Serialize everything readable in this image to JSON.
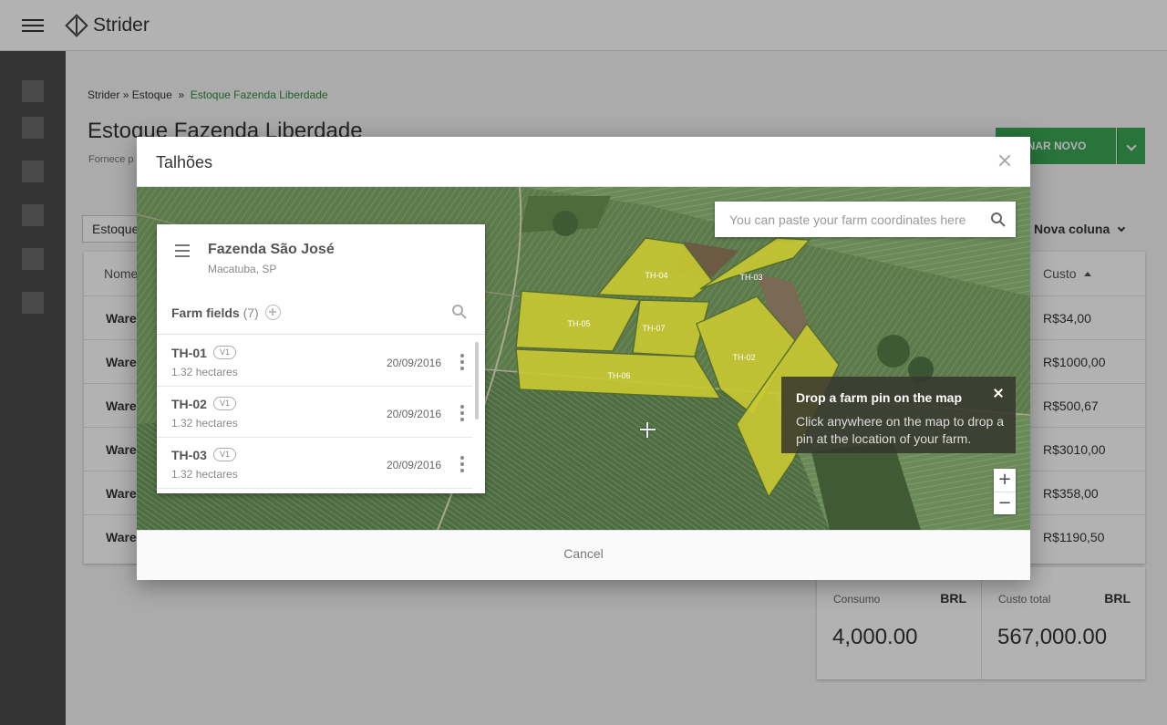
{
  "app": {
    "brand": "Strider"
  },
  "breadcrumb": {
    "root": "Strider",
    "sep1": "»",
    "section": "Estoque",
    "sep2": "»",
    "current": "Estoque Fazenda Liberdade"
  },
  "page": {
    "title": "Estoque Fazenda Liberdade",
    "subtitle": "Fornece p",
    "add_button": "ICIONAR NOVO",
    "filter_value": "Estoque",
    "new_column": "Nova coluna"
  },
  "table": {
    "col_name": "Nome",
    "col_cost": "Custo",
    "rows": [
      {
        "name": "Warel",
        "cost": "R$34,00"
      },
      {
        "name": "Warel",
        "cost": "R$1000,00"
      },
      {
        "name": "Warel",
        "cost": "R$500,67"
      },
      {
        "name": "Warel",
        "cost": "R$3010,00"
      },
      {
        "name": "Warel",
        "cost": "R$358,00"
      },
      {
        "name": "Warel",
        "cost": "R$1190,50"
      }
    ]
  },
  "summary": {
    "consumo_label": "Consumo",
    "consumo_currency": "BRL",
    "consumo_value": "4,000.00",
    "total_label": "Custo total",
    "total_currency": "BRL",
    "total_value": "567,000.00"
  },
  "modal": {
    "title": "Talhões",
    "cancel": "Cancel",
    "farm": {
      "name": "Fazenda São José",
      "location": "Macatuba, SP"
    },
    "fields_title": "Farm fields",
    "fields_count": "(7)",
    "fields": [
      {
        "name": "TH-01",
        "version": "V1",
        "area": "1.32 hectares",
        "date": "20/09/2016"
      },
      {
        "name": "TH-02",
        "version": "V1",
        "area": "1.32 hectares",
        "date": "20/09/2016"
      },
      {
        "name": "TH-03",
        "version": "V1",
        "area": "1.32 hectares",
        "date": "20/09/2016"
      }
    ],
    "search_placeholder": "You can paste your farm coordinates here",
    "tooltip": {
      "title": "Drop a farm pin on the map",
      "body": "Click anywhere on the map to drop a pin at the location of your farm."
    },
    "zoom_in": "+",
    "zoom_out": "−",
    "map_labels": {
      "th04": "TH-04",
      "th03": "TH-03",
      "th05": "TH-05",
      "th07": "TH-07",
      "th02": "TH-02",
      "th06": "TH-06"
    },
    "colors": {
      "field_fill": "#c8c832",
      "primary_green": "#3aa655"
    }
  }
}
